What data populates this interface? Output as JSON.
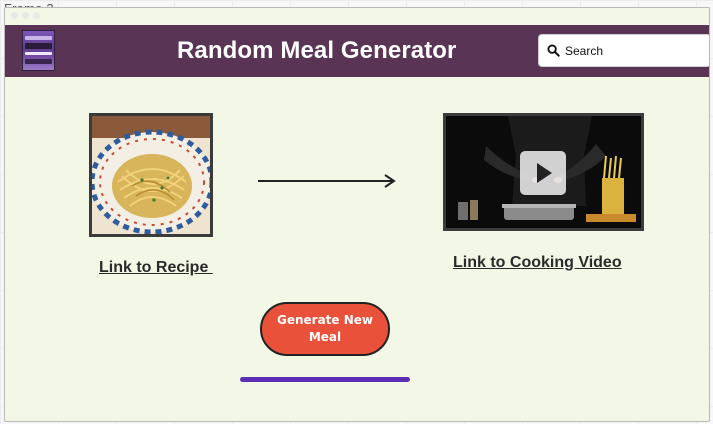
{
  "frame": {
    "label": "Frame 2"
  },
  "header": {
    "title": "Random Meal Generator",
    "logo_icon": "meal-logo-icon",
    "background_color": "#5a3454"
  },
  "search": {
    "placeholder": "Search",
    "icon": "search-icon"
  },
  "recipe": {
    "link_label": "Link to Recipe ",
    "image": "spaghetti-photo"
  },
  "video": {
    "link_label": "Link to Cooking Video",
    "icon": "play-icon"
  },
  "generate_button": {
    "label": "Generate New Meal",
    "color": "#e9513a"
  },
  "colors": {
    "page_background": "#f3f7e6",
    "accent_bar": "#5a2fb5"
  }
}
